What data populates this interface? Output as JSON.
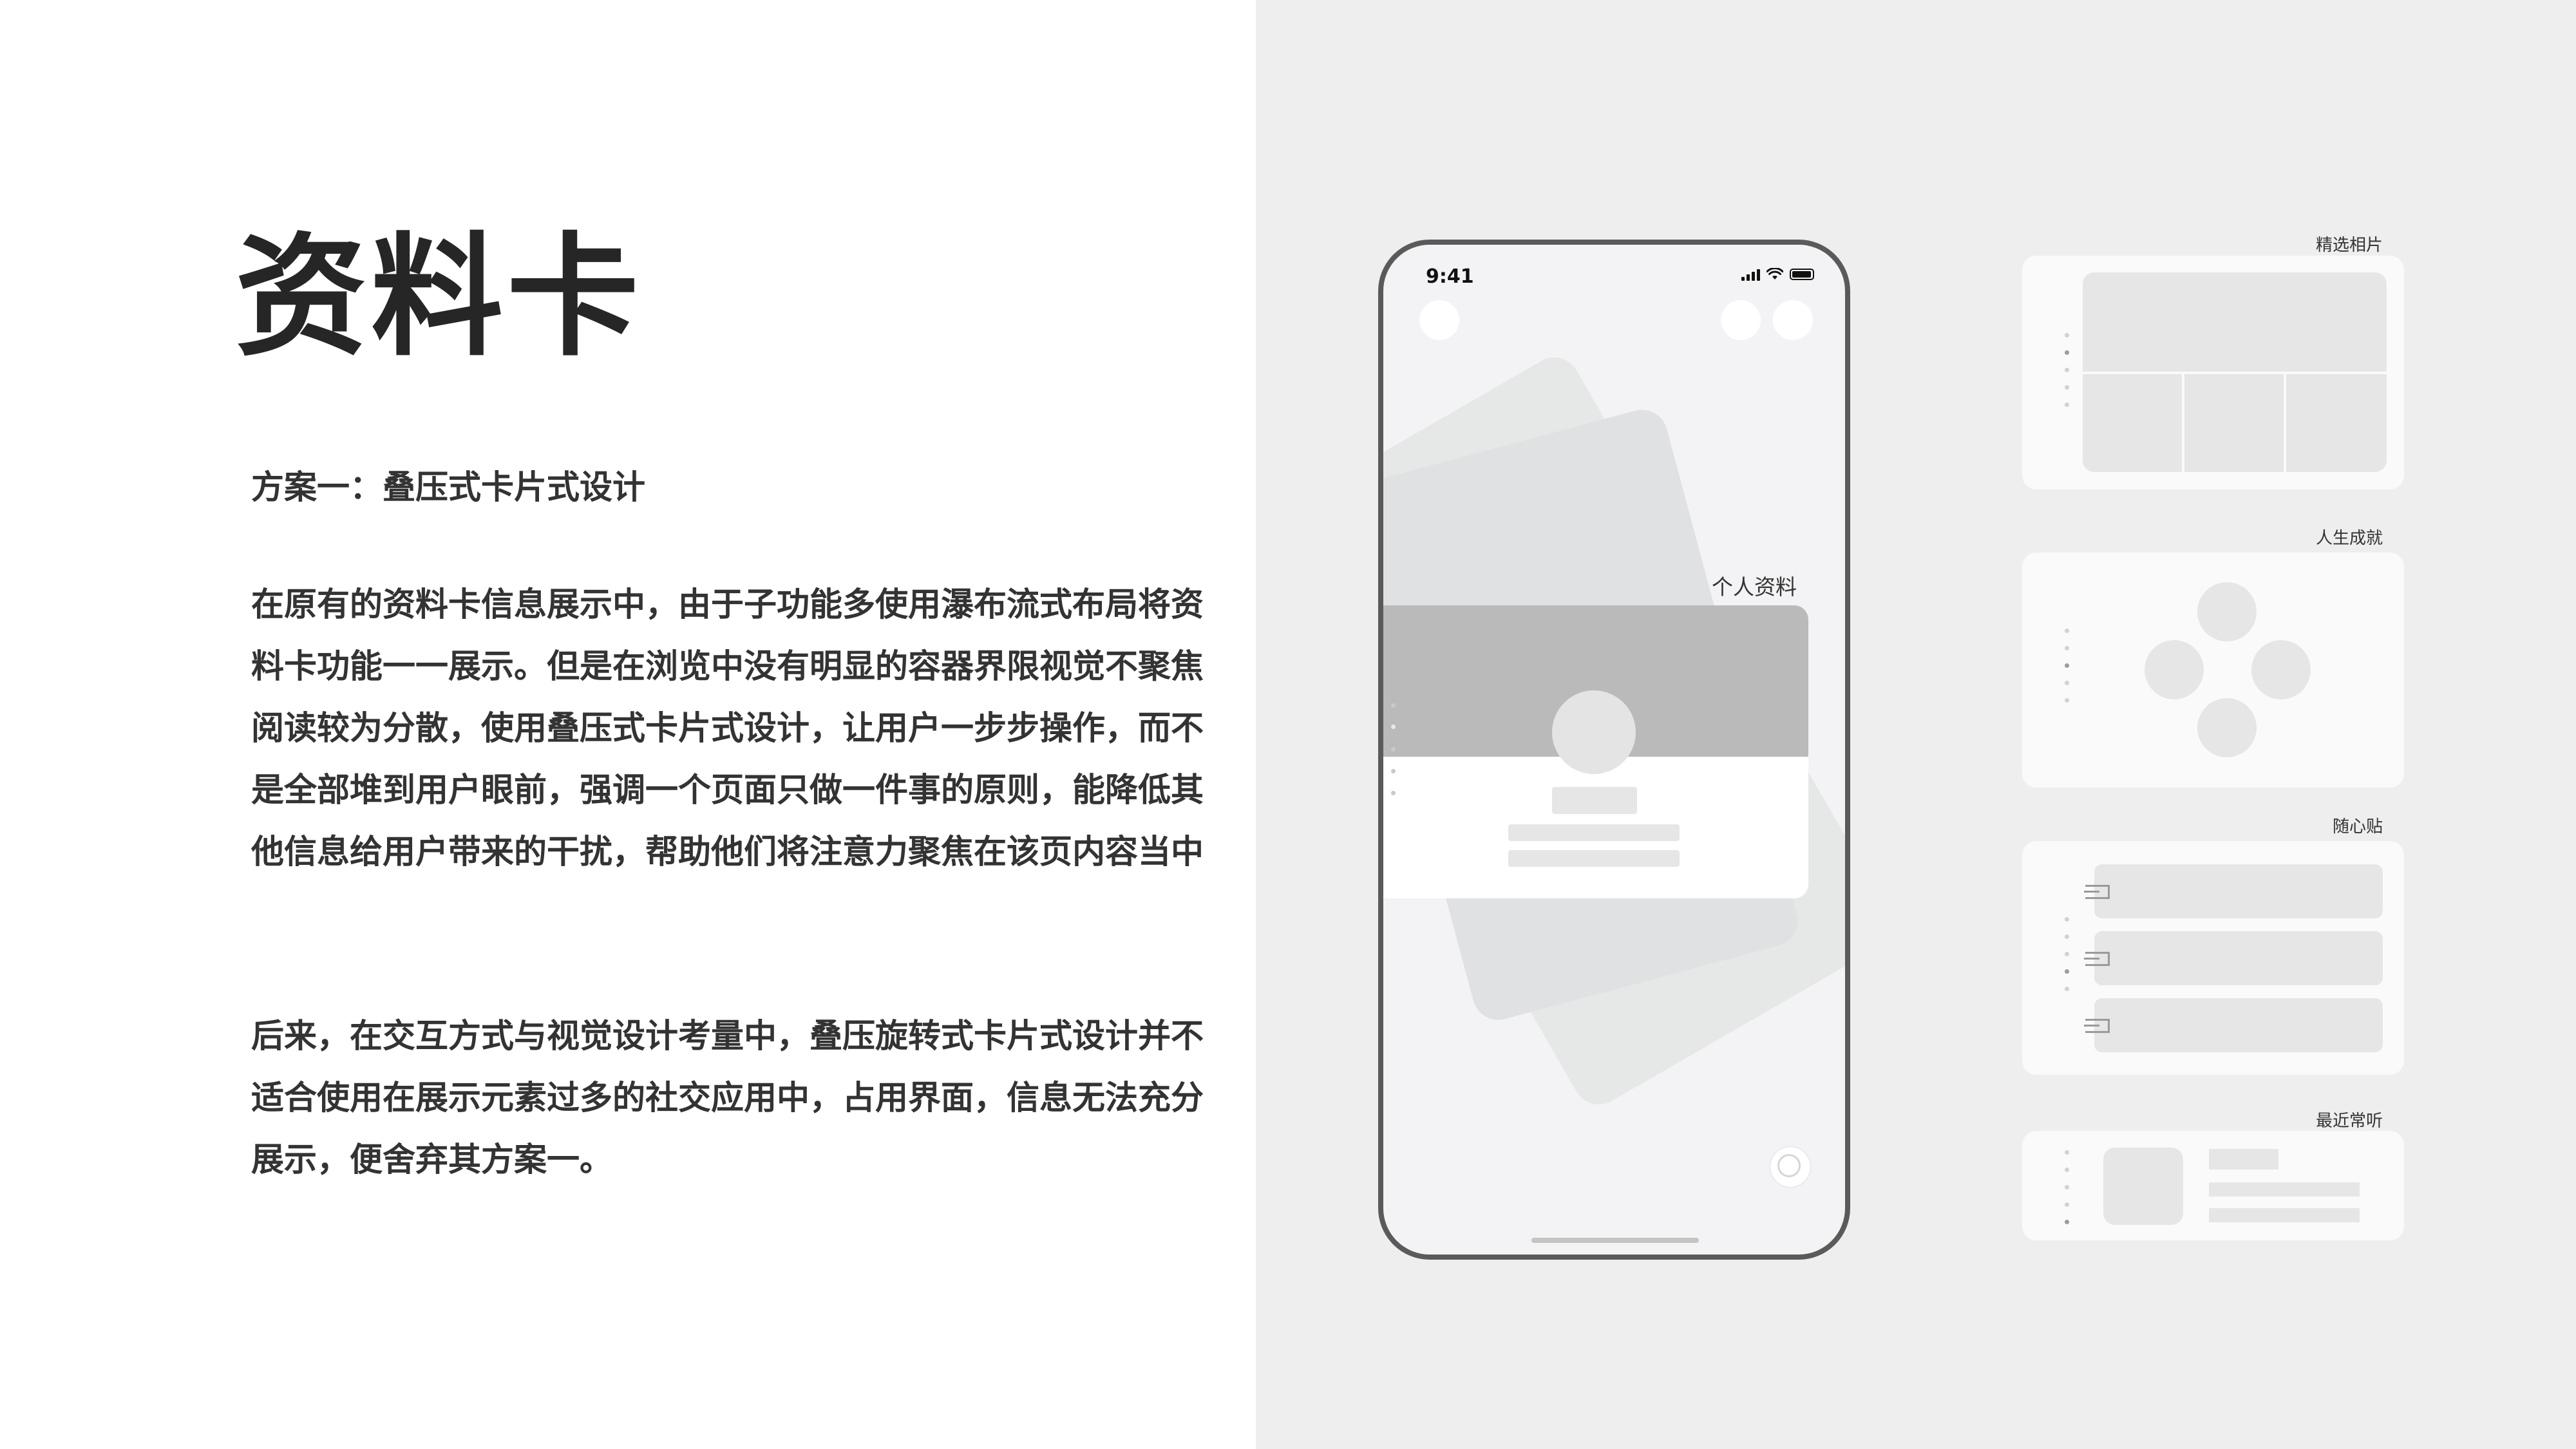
{
  "page": {
    "title": "资料卡",
    "subtitle": "方案一：叠压式卡片式设计",
    "paragraph1": "在原有的资料卡信息展示中，由于子功能多使用瀑布流式布局将资料卡功能一一展示。但是在浏览中没有明显的容器界限视觉不聚焦阅读较为分散，使用叠压式卡片式设计，让用户一步步操作，而不是全部堆到用户眼前，强调一个页面只做一件事的原则，能降低其他信息给用户带来的干扰，帮助他们将注意力聚焦在该页内容当中",
    "paragraph2": "后来，在交互方式与视觉设计考量中，叠压旋转式卡片式设计并不适合使用在展示元素过多的社交应用中，占用界面，信息无法充分展示，便舍弃其方案一。"
  },
  "phone": {
    "time": "9:41",
    "profile_label": "个人资料",
    "status_icons": [
      "signal-icon",
      "wifi-icon",
      "battery-icon"
    ]
  },
  "widgets": {
    "photos_label": "精选相片",
    "achievements_label": "人生成就",
    "notes_label": "随心贴",
    "music_label": "最近常听"
  },
  "colors": {
    "left_background": "#ffffff",
    "right_background": "#eeeeee",
    "phone_frame": "#5a5a5a",
    "profile_header": "#bbbabb",
    "placeholder": "#e6e6e6"
  }
}
